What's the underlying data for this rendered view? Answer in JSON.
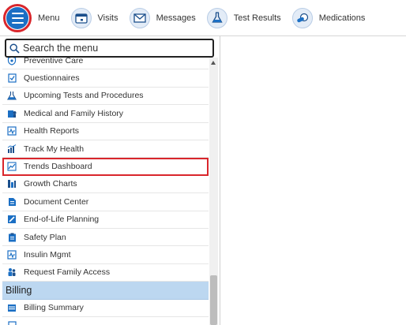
{
  "toolbar": {
    "menu": {
      "label": "Menu",
      "icon": "hamburger-icon"
    },
    "visits": {
      "label": "Visits",
      "icon": "calendar-icon"
    },
    "messages": {
      "label": "Messages",
      "icon": "envelope-icon"
    },
    "test_results": {
      "label": "Test Results",
      "icon": "flask-icon"
    },
    "medications": {
      "label": "Medications",
      "icon": "pill-icon"
    }
  },
  "search": {
    "placeholder": "Search the menu"
  },
  "menu_items": [
    {
      "label": "Preventive Care",
      "icon": "shield-icon"
    },
    {
      "label": "Questionnaires",
      "icon": "checklist-icon"
    },
    {
      "label": "Upcoming Tests and Procedures",
      "icon": "flask-icon"
    },
    {
      "label": "Medical and Family History",
      "icon": "family-icon"
    },
    {
      "label": "Health Reports",
      "icon": "pulse-icon"
    },
    {
      "label": "Track My Health",
      "icon": "bar-chart-icon"
    },
    {
      "label": "Trends Dashboard",
      "icon": "trend-line-icon",
      "highlighted": true
    },
    {
      "label": "Growth Charts",
      "icon": "growth-chart-icon"
    },
    {
      "label": "Document Center",
      "icon": "document-icon"
    },
    {
      "label": "End-of-Life Planning",
      "icon": "pencil-icon"
    },
    {
      "label": "Safety Plan",
      "icon": "clipboard-icon"
    },
    {
      "label": "Insulin Mgmt",
      "icon": "pulse-icon"
    },
    {
      "label": "Request Family Access",
      "icon": "people-icon"
    }
  ],
  "billing": {
    "section_label": "Billing",
    "items": [
      {
        "label": "Billing Summary",
        "icon": "billing-icon"
      }
    ]
  },
  "colors": {
    "accent_blue": "#1b6fc4",
    "highlight_red": "#d9262c",
    "section_bg": "#bcd7f0"
  }
}
